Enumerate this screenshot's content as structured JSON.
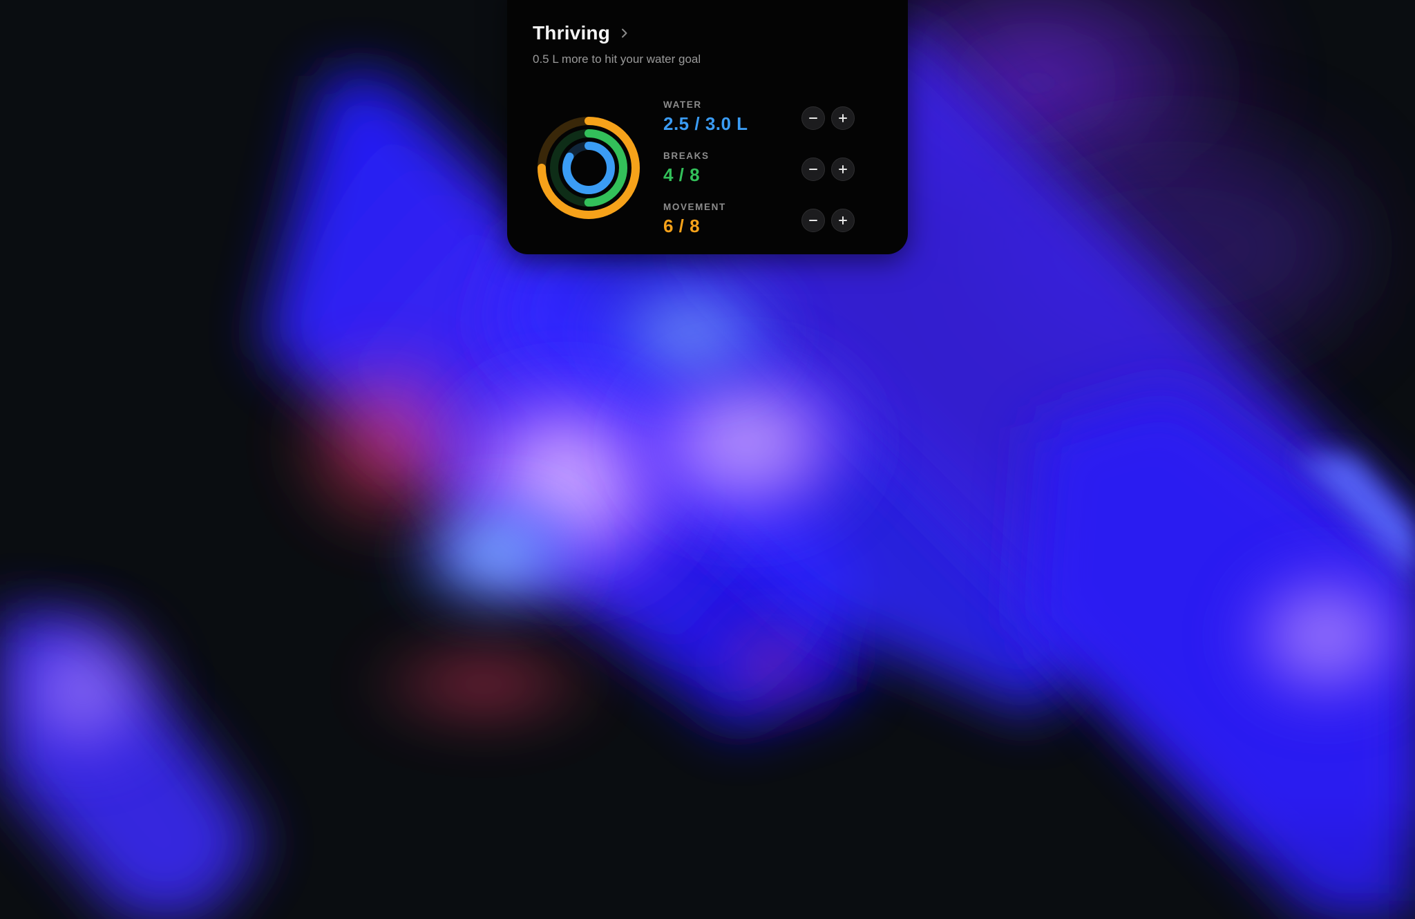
{
  "widget": {
    "title": "Thriving",
    "subtitle": "0.5 L more to hit your water goal",
    "metrics": [
      {
        "label": "WATER",
        "value": "2.5 / 3.0 L",
        "color": "#3b9cf4",
        "progress": 0.8333
      },
      {
        "label": "BREAKS",
        "value": "4 / 8",
        "color": "#33c05a",
        "progress": 0.5
      },
      {
        "label": "MOVEMENT",
        "value": "6 / 8",
        "color": "#f6a21a",
        "progress": 0.75
      }
    ]
  },
  "icons": {
    "chevron": "chevron-right-icon",
    "minus": "minus-icon",
    "plus": "plus-icon"
  }
}
